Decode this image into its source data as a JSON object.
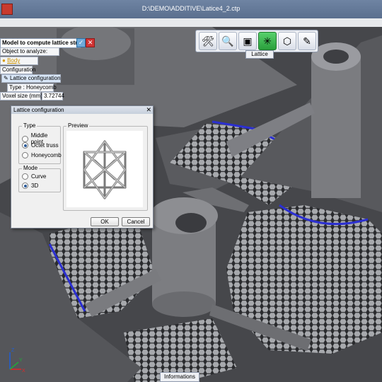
{
  "window": {
    "title": "D:\\DEMO\\ADDITIVE\\Latice4_2.ctp"
  },
  "toolbar": {
    "tab_label": "Lattice",
    "icons": [
      "tools-icon",
      "analyze-icon",
      "bounding-box-icon",
      "lattice-icon",
      "mesh-icon",
      "edit-icon"
    ]
  },
  "panel": {
    "header": "Model to compute lattice structure",
    "object_label": "Object to analyze:",
    "body_label": "Body",
    "configuration_label": "Configuration",
    "lattice_config_label": "Lattice configuration",
    "type_line": "Type : Honeycomb",
    "voxel_label": "Voxel size (mm):",
    "voxel_value": "3.72744"
  },
  "dialog": {
    "title": "Lattice configuration",
    "type_group": "Type",
    "type_options": [
      "Middle point",
      "Octet truss",
      "Honeycomb"
    ],
    "type_selected": "Octet truss",
    "mode_group": "Mode",
    "mode_options": [
      "Curve",
      "3D"
    ],
    "mode_selected": "3D",
    "preview_label": "Preview",
    "ok_label": "OK",
    "cancel_label": "Cancel"
  },
  "bottom": {
    "info_tab": "Informations"
  },
  "axis": {
    "x": "X",
    "y": "Y",
    "z": "Z"
  },
  "colors": {
    "accent_blue": "#2b2fd1",
    "titlebar": "#6f84a3",
    "highlight_green": "#3cbf4f"
  }
}
